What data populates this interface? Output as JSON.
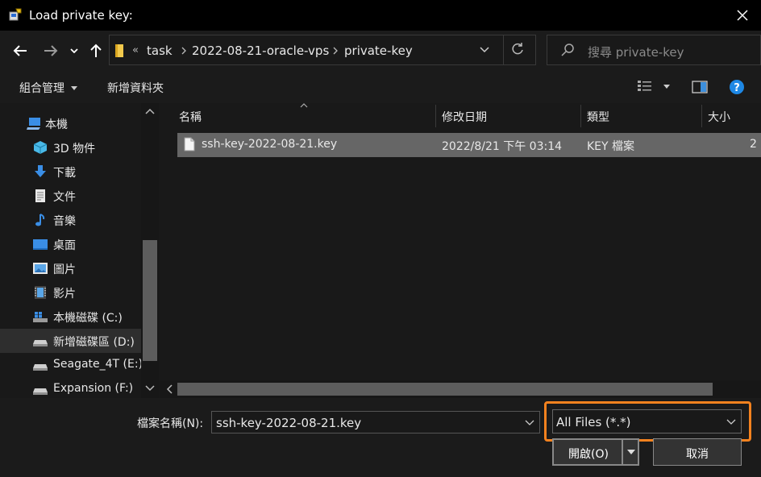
{
  "window": {
    "title": "Load private key:"
  },
  "address": {
    "overflow_glyph": "«",
    "crumbs": [
      "task",
      "2022-08-21-oracle-vps",
      "private-key"
    ]
  },
  "search": {
    "placeholder": "搜尋 private-key"
  },
  "toolbar": {
    "organize_label": "組合管理",
    "new_folder_label": "新增資料夾"
  },
  "sidebar": {
    "items": [
      {
        "label": "本機",
        "icon": "computer-icon"
      },
      {
        "label": "3D 物件",
        "icon": "3d-objects-icon"
      },
      {
        "label": "下載",
        "icon": "download-icon"
      },
      {
        "label": "文件",
        "icon": "documents-icon"
      },
      {
        "label": "音樂",
        "icon": "music-icon"
      },
      {
        "label": "桌面",
        "icon": "desktop-icon"
      },
      {
        "label": "圖片",
        "icon": "pictures-icon"
      },
      {
        "label": "影片",
        "icon": "videos-icon"
      },
      {
        "label": "本機磁碟 (C:)",
        "icon": "windows-drive-icon"
      },
      {
        "label": "新增磁碟區 (D:)",
        "icon": "drive-icon"
      },
      {
        "label": "Seagate_4T (E:)",
        "icon": "drive-icon"
      },
      {
        "label": "Expansion (F:)",
        "icon": "drive-icon"
      }
    ]
  },
  "columns": {
    "name": "名稱",
    "modified": "修改日期",
    "type": "類型",
    "size": "大小"
  },
  "files": [
    {
      "name": "ssh-key-2022-08-21.key",
      "modified": "2022/8/21 下午 03:14",
      "type": "KEY 檔案",
      "size": "2"
    }
  ],
  "footer": {
    "filename_label": "檔案名稱(N):",
    "filename_value": "ssh-key-2022-08-21.key",
    "filter_value": "All Files (*.*)",
    "open_label": "開啟(O)",
    "cancel_label": "取消"
  },
  "colors": {
    "highlight": "#f5821f",
    "selected_row": "#666666",
    "help": "#1e88e5"
  }
}
